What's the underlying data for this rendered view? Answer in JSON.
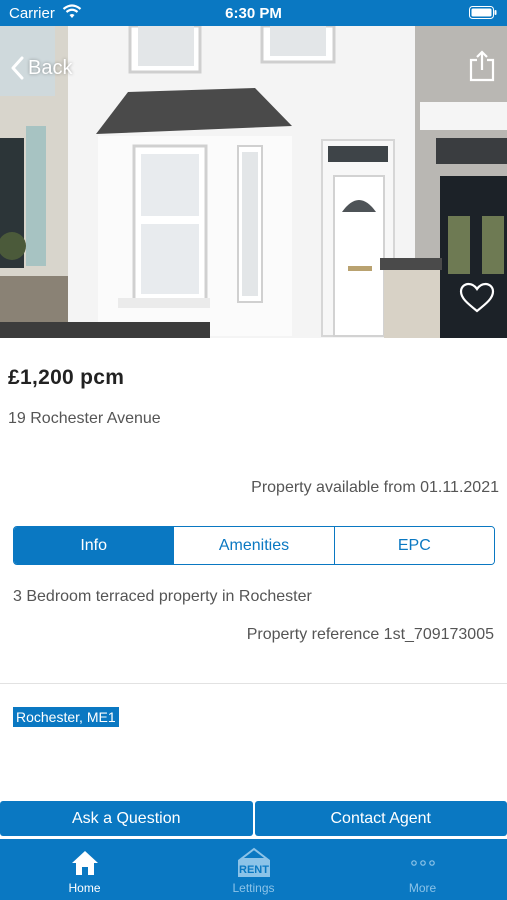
{
  "status_bar": {
    "carrier": "Carrier",
    "time": "6:30 PM"
  },
  "nav": {
    "back_label": "Back"
  },
  "listing": {
    "price": "£1,200 pcm",
    "address": "19 Rochester Avenue",
    "availability": "Property available from 01.11.2021",
    "description": "3 Bedroom terraced property in Rochester",
    "reference": "Property reference 1st_709173005",
    "location": "Rochester, ME1",
    "favorited": false
  },
  "tabs": [
    {
      "label": "Info",
      "active": true
    },
    {
      "label": "Amenities",
      "active": false
    },
    {
      "label": "EPC",
      "active": false
    }
  ],
  "actions": {
    "ask_label": "Ask a Question",
    "contact_label": "Contact Agent"
  },
  "tab_bar": [
    {
      "label": "Home",
      "icon": "home-icon",
      "active": true
    },
    {
      "label": "Lettings",
      "icon": "rent-icon",
      "active": false
    },
    {
      "label": "More",
      "icon": "more-icon",
      "active": false
    }
  ],
  "colors": {
    "accent": "#0a78c2",
    "text": "#555555",
    "tab_inactive": "#8cc3e8"
  }
}
